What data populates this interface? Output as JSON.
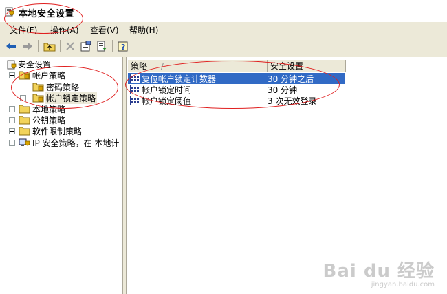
{
  "window": {
    "title": "本地安全设置"
  },
  "menu": [
    {
      "label": "文件(F)"
    },
    {
      "label": "操作(A)"
    },
    {
      "label": "查看(V)"
    },
    {
      "label": "帮助(H)"
    }
  ],
  "toolbar": {
    "icons": [
      "back-arrow-icon",
      "forward-arrow-icon",
      "up-folder-icon",
      "delete-icon",
      "properties-icon",
      "export-list-icon",
      "help-icon"
    ]
  },
  "tree": {
    "root": "安全设置",
    "account_policy": "帐户策略",
    "password_policy": "密码策略",
    "lockout_policy": "帐户锁定策略",
    "local_policy": "本地策略",
    "public_key_policy": "公钥策略",
    "software_restriction": "软件限制策略",
    "ip_security": "IP 安全策略，在 本地计"
  },
  "list": {
    "columns": {
      "policy": "策略",
      "setting": "安全设置",
      "sort_indicator": "/"
    },
    "rows": [
      {
        "policy": "复位帐户锁定计数器",
        "setting": "30 分钟之后"
      },
      {
        "policy": "帐户锁定时间",
        "setting": "30 分钟"
      },
      {
        "policy": "帐户锁定阈值",
        "setting": "3 次无效登录"
      }
    ]
  },
  "watermark": {
    "brand": "Bai du 经验",
    "url": "jingyan.baidu.com"
  },
  "colors": {
    "selection": "#316ac5",
    "annotation": "#e02020",
    "chrome": "#ece9d8"
  }
}
